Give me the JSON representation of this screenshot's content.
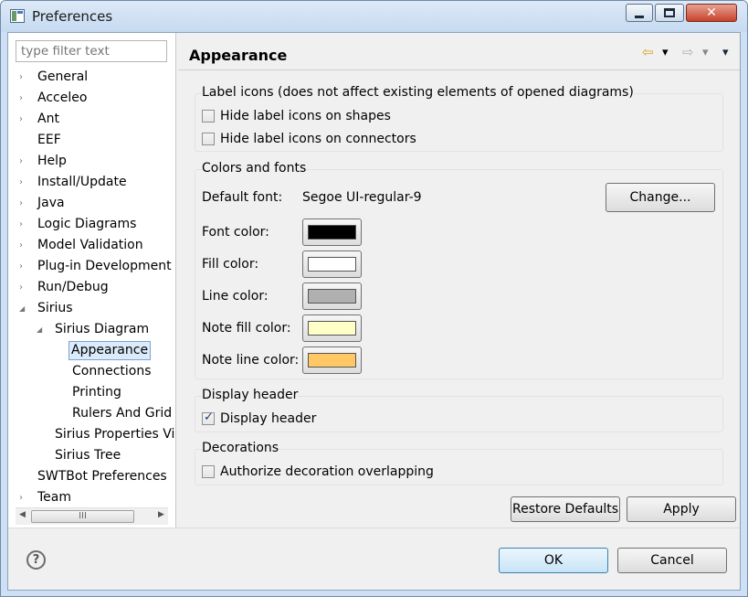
{
  "window": {
    "title": "Preferences",
    "min_glyph": "",
    "close_glyph": "✕"
  },
  "sidebar": {
    "filter_placeholder": "type filter text",
    "items": [
      {
        "label": "General",
        "arrow": "›"
      },
      {
        "label": "Acceleo",
        "arrow": "›"
      },
      {
        "label": "Ant",
        "arrow": "›"
      },
      {
        "label": "EEF",
        "arrow": ""
      },
      {
        "label": "Help",
        "arrow": "›"
      },
      {
        "label": "Install/Update",
        "arrow": "›"
      },
      {
        "label": "Java",
        "arrow": "›"
      },
      {
        "label": "Logic Diagrams",
        "arrow": "›"
      },
      {
        "label": "Model Validation",
        "arrow": "›"
      },
      {
        "label": "Plug-in Development",
        "arrow": "›"
      },
      {
        "label": "Run/Debug",
        "arrow": "›"
      },
      {
        "label": "Sirius",
        "arrow": "◢"
      },
      {
        "label": "Sirius Diagram",
        "arrow": "◢"
      },
      {
        "label": "Appearance",
        "arrow": "",
        "selected": true
      },
      {
        "label": "Connections",
        "arrow": ""
      },
      {
        "label": "Printing",
        "arrow": ""
      },
      {
        "label": "Rulers And Grid",
        "arrow": ""
      },
      {
        "label": "Sirius Properties Vi",
        "arrow": ""
      },
      {
        "label": "Sirius Tree",
        "arrow": ""
      },
      {
        "label": "SWTBot Preferences",
        "arrow": ""
      },
      {
        "label": "Team",
        "arrow": "›"
      }
    ],
    "scroll_left": "◀",
    "scroll_right": "▶",
    "scroll_grip": "III"
  },
  "page": {
    "title": "Appearance",
    "nav_back": "⇦",
    "nav_back_menu": "▾",
    "nav_forward": "⇨",
    "nav_forward_menu": "▾",
    "nav_menu": "▾"
  },
  "label_icons": {
    "title": "Label icons (does not affect existing elements of opened diagrams)",
    "hide_on_shapes": "Hide label icons on shapes",
    "hide_on_connectors": "Hide label icons on connectors",
    "hide_on_shapes_checked": false,
    "hide_on_connectors_checked": false
  },
  "colors_fonts": {
    "title": "Colors and fonts",
    "default_font_label": "Default font:",
    "default_font_value": "Segoe UI-regular-9",
    "change_button": "Change...",
    "font_color_label": "Font color:",
    "fill_color_label": "Fill color:",
    "line_color_label": "Line color:",
    "note_fill_color_label": "Note fill color:",
    "note_line_color_label": "Note line color:",
    "font_color": "#000000",
    "fill_color": "#ffffff",
    "line_color": "#b0b0b0",
    "note_fill_color": "#ffffc8",
    "note_line_color": "#ffc864"
  },
  "display_header": {
    "title": "Display header",
    "checkbox_label": "Display header",
    "checked": true
  },
  "decorations": {
    "title": "Decorations",
    "checkbox_label": "Authorize decoration overlapping",
    "checked": false
  },
  "buttons": {
    "restore_defaults": "Restore Defaults",
    "apply": "Apply",
    "ok": "OK",
    "cancel": "Cancel"
  },
  "help": {
    "glyph": "?"
  }
}
